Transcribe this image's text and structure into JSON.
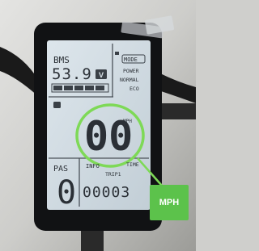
{
  "display": {
    "bms_label": "BMS",
    "voltage": "53.9",
    "voltage_unit": "V",
    "mode_label": "MODE",
    "modes": [
      "POWER",
      "NORMAL",
      "ECO"
    ],
    "speed": "00",
    "speed_unit": "MPH",
    "pas_label": "PAS",
    "pas_level": "0",
    "info_labels": [
      "INFO",
      "TIME"
    ],
    "trip_label": "TRIP1",
    "odometer": "00003"
  },
  "callout": {
    "label": "MPH",
    "color": "#5cc24b"
  }
}
